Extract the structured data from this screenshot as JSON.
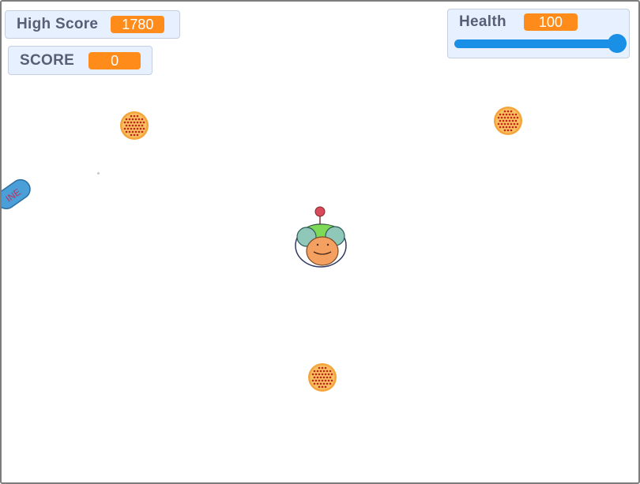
{
  "monitors": {
    "high_score": {
      "label": "High Score",
      "value": "1780"
    },
    "score": {
      "label": "SCORE",
      "value": "0"
    },
    "health": {
      "label": "Health",
      "value": "100",
      "slider_level": 1.0
    }
  },
  "sprites": {
    "side_sprite_text": "INE",
    "pizzas": 3,
    "player": "astronaut-character"
  },
  "colors": {
    "monitor_bg": "#e6f0ff",
    "value_badge": "#ff8c1a",
    "slider": "#1a8fe6",
    "side_sprite": "#4a9fd8",
    "side_sprite_text": "#c0305a"
  }
}
